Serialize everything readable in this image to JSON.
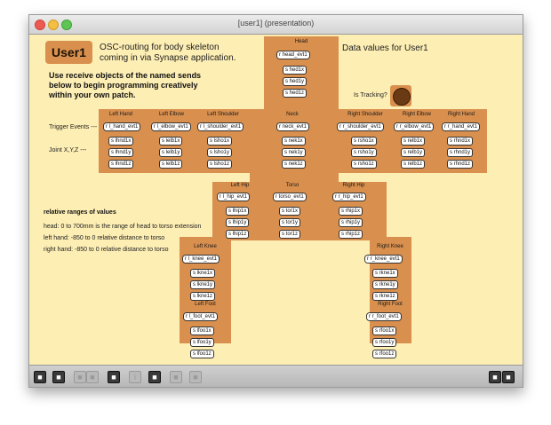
{
  "window": {
    "title": "[user1] (presentation)"
  },
  "header": {
    "badge": "User1",
    "desc_line1": "OSC-routing for body skeleton",
    "desc_line2": "coming in via Synapse application.",
    "instr_line1": "Use receive objects of the named sends",
    "instr_line2": "below to begin programming creatively",
    "instr_line3": "within your own patch.",
    "data_values": "Data values for User1",
    "is_tracking": "Is Tracking?"
  },
  "head": {
    "title": "Head",
    "evt": "r head_evt1",
    "x": "s hed1x",
    "y": "s hed1y",
    "z": "s hed1z"
  },
  "row_labels": {
    "trigger": "Trigger Events  ---",
    "joint": "Joint X,Y,Z   ---"
  },
  "upper": [
    {
      "title": "Left Hand",
      "evt": "r l_hand_evt1",
      "x": "s lhnd1x",
      "y": "s lhnd1y",
      "z": "s lhnd1z"
    },
    {
      "title": "Left Elbow",
      "evt": "r l_elbow_evt1",
      "x": "s lelb1x",
      "y": "s lelb1y",
      "z": "s lelb1z"
    },
    {
      "title": "Left Shoulder",
      "evt": "r l_shoulder_evt1",
      "x": "s lsho1x",
      "y": "s lsho1y",
      "z": "s lsho1z"
    },
    {
      "title": "Neck",
      "evt": "r neck_evt1",
      "x": "s nek1x",
      "y": "s nek1y",
      "z": "s nek1z"
    },
    {
      "title": "Right Shoulder",
      "evt": "r r_shoulder_evt1",
      "x": "s rsho1x",
      "y": "s rsho1y",
      "z": "s rsho1z"
    },
    {
      "title": "Right Elbow",
      "evt": "r r_elbow_evt1",
      "x": "s relb1x",
      "y": "s relb1y",
      "z": "s relb1z"
    },
    {
      "title": "Right Hand",
      "evt": "r r_hand_evt1",
      "x": "s rhnd1x",
      "y": "s rhnd1y",
      "z": "s rhnd1z"
    }
  ],
  "middle": [
    {
      "title": "Left Hip",
      "evt": "r l_hip_evt1",
      "x": "s lhip1x",
      "y": "s lhip1y",
      "z": "s lhip1z"
    },
    {
      "title": "Torso",
      "evt": "r torso_evt1",
      "x": "s tor1x",
      "y": "s tor1y",
      "z": "s tor1z"
    },
    {
      "title": "Right Hip",
      "evt": "r r_hip_evt1",
      "x": "s rhip1x",
      "y": "s rhip1y",
      "z": "s rhip1z"
    }
  ],
  "legs": [
    {
      "title": "Left Knee",
      "evt": "r l_knee_evt1",
      "x": "s lkne1x",
      "y": "s lkne1y",
      "z": "s lkne1z"
    },
    {
      "title": "Right Knee",
      "evt": "r r_knee_evt1",
      "x": "s rkne1x",
      "y": "s rkne1y",
      "z": "s rkne1z"
    },
    {
      "title": "Left Foot",
      "evt": "r l_foot_evt1",
      "x": "s lfoo1x",
      "y": "s lfoo1y",
      "z": "s lfoo1z"
    },
    {
      "title": "Right Foot",
      "evt": "r r_foot_evt1",
      "x": "s rfoo1x",
      "y": "s rfoo1y",
      "z": "s rfoo1z"
    }
  ],
  "ranges": {
    "title": "relative ranges of values",
    "line1": "head: 0 to 700mm is the range of head to torso extension",
    "line2": "left hand: -850 to 0 relative distance to torso",
    "line3": "right hand: -850 to 0 relative distance to torso"
  },
  "colors": {
    "background": "#fdeeb4",
    "panel": "#d98f4d"
  }
}
